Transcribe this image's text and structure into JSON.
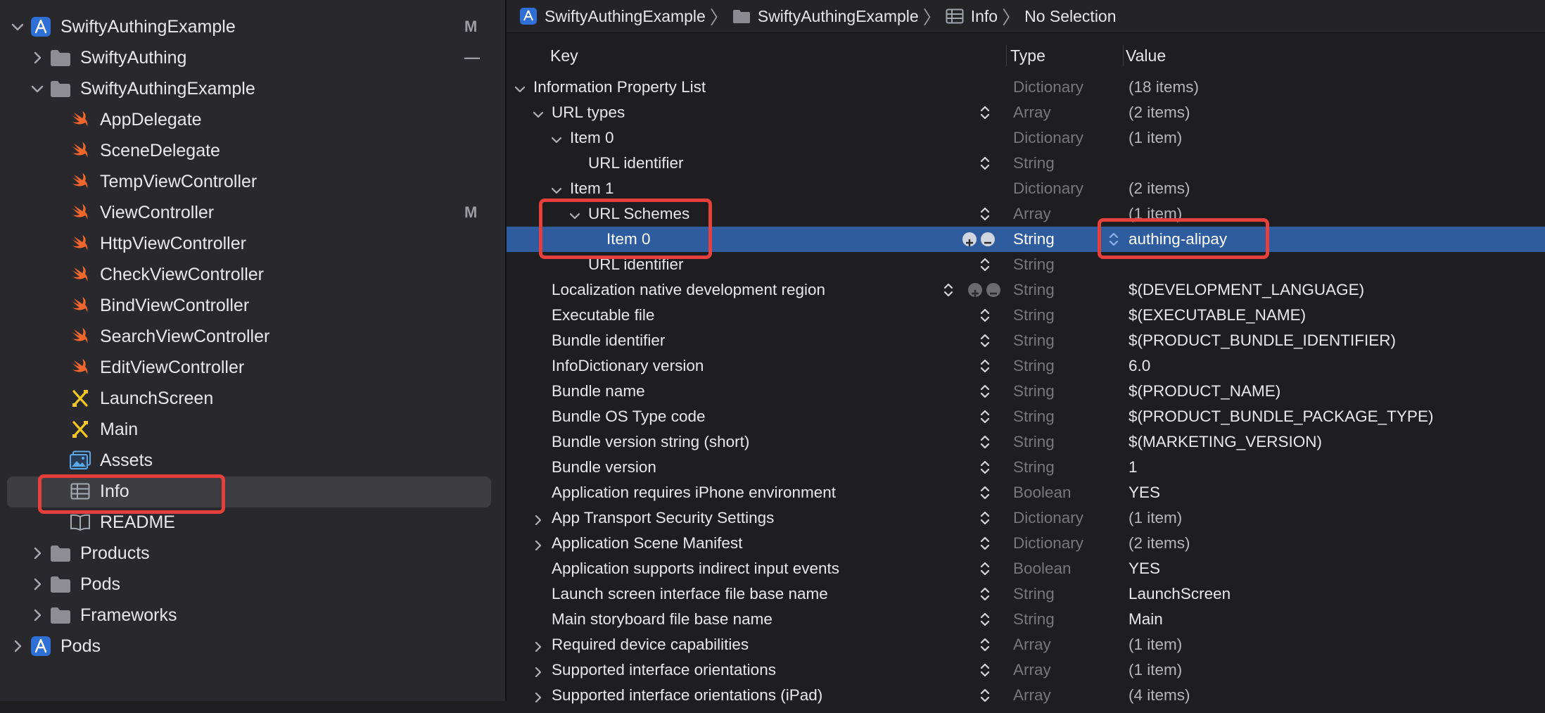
{
  "navigator": {
    "items": [
      {
        "label": "SwiftyAuthingExample",
        "icon": "project-icon",
        "status": "M"
      },
      {
        "label": "SwiftyAuthing",
        "icon": "folder-icon",
        "status": "—"
      },
      {
        "label": "SwiftyAuthingExample",
        "icon": "folder-icon",
        "status": ""
      },
      {
        "label": "AppDelegate",
        "icon": "swift-file-icon",
        "status": ""
      },
      {
        "label": "SceneDelegate",
        "icon": "swift-file-icon",
        "status": ""
      },
      {
        "label": "TempViewController",
        "icon": "swift-file-icon",
        "status": ""
      },
      {
        "label": "ViewController",
        "icon": "swift-file-icon",
        "status": "M"
      },
      {
        "label": "HttpViewController",
        "icon": "swift-file-icon",
        "status": ""
      },
      {
        "label": "CheckViewController",
        "icon": "swift-file-icon",
        "status": ""
      },
      {
        "label": "BindViewController",
        "icon": "swift-file-icon",
        "status": ""
      },
      {
        "label": "SearchViewController",
        "icon": "swift-file-icon",
        "status": ""
      },
      {
        "label": "EditViewController",
        "icon": "swift-file-icon",
        "status": ""
      },
      {
        "label": "LaunchScreen",
        "icon": "storyboard-icon",
        "status": ""
      },
      {
        "label": "Main",
        "icon": "storyboard-icon",
        "status": ""
      },
      {
        "label": "Assets",
        "icon": "assets-icon",
        "status": ""
      },
      {
        "label": "Info",
        "icon": "plist-table-icon",
        "status": ""
      },
      {
        "label": "README",
        "icon": "book-icon",
        "status": ""
      },
      {
        "label": "Products",
        "icon": "folder-icon",
        "status": ""
      },
      {
        "label": "Pods",
        "icon": "folder-icon",
        "status": ""
      },
      {
        "label": "Frameworks",
        "icon": "folder-icon",
        "status": ""
      },
      {
        "label": "Pods",
        "icon": "project-icon",
        "status": ""
      }
    ]
  },
  "jumpbar": {
    "crumbs": [
      "SwiftyAuthingExample",
      "SwiftyAuthingExample",
      "Info",
      "No Selection"
    ]
  },
  "columns": {
    "key": "Key",
    "type": "Type",
    "value": "Value"
  },
  "plist": {
    "rows": [
      {
        "key": "Information Property List",
        "type": "Dictionary",
        "value": "(18 items)"
      },
      {
        "key": "URL types",
        "type": "Array",
        "value": "(2 items)"
      },
      {
        "key": "Item 0",
        "type": "Dictionary",
        "value": "(1 item)"
      },
      {
        "key": "URL identifier",
        "type": "String",
        "value": ""
      },
      {
        "key": "Item 1",
        "type": "Dictionary",
        "value": "(2 items)"
      },
      {
        "key": "URL Schemes",
        "type": "Array",
        "value": "(1 item)"
      },
      {
        "key": "Item 0",
        "type": "String",
        "value": "authing-alipay"
      },
      {
        "key": "URL identifier",
        "type": "String",
        "value": ""
      },
      {
        "key": "Localization native development region",
        "type": "String",
        "value": "$(DEVELOPMENT_LANGUAGE)"
      },
      {
        "key": "Executable file",
        "type": "String",
        "value": "$(EXECUTABLE_NAME)"
      },
      {
        "key": "Bundle identifier",
        "type": "String",
        "value": "$(PRODUCT_BUNDLE_IDENTIFIER)"
      },
      {
        "key": "InfoDictionary version",
        "type": "String",
        "value": "6.0"
      },
      {
        "key": "Bundle name",
        "type": "String",
        "value": "$(PRODUCT_NAME)"
      },
      {
        "key": "Bundle OS Type code",
        "type": "String",
        "value": "$(PRODUCT_BUNDLE_PACKAGE_TYPE)"
      },
      {
        "key": "Bundle version string (short)",
        "type": "String",
        "value": "$(MARKETING_VERSION)"
      },
      {
        "key": "Bundle version",
        "type": "String",
        "value": "1"
      },
      {
        "key": "Application requires iPhone environment",
        "type": "Boolean",
        "value": "YES"
      },
      {
        "key": "App Transport Security Settings",
        "type": "Dictionary",
        "value": "(1 item)"
      },
      {
        "key": "Application Scene Manifest",
        "type": "Dictionary",
        "value": "(2 items)"
      },
      {
        "key": "Application supports indirect input events",
        "type": "Boolean",
        "value": "YES"
      },
      {
        "key": "Launch screen interface file base name",
        "type": "String",
        "value": "LaunchScreen"
      },
      {
        "key": "Main storyboard file base name",
        "type": "String",
        "value": "Main"
      },
      {
        "key": "Required device capabilities",
        "type": "Array",
        "value": "(1 item)"
      },
      {
        "key": "Supported interface orientations",
        "type": "Array",
        "value": "(1 item)"
      },
      {
        "key": "Supported interface orientations (iPad)",
        "type": "Array",
        "value": "(4 items)"
      }
    ]
  },
  "colors": {
    "selection": "#2f5c9e",
    "highlight_box": "#e5403b",
    "swift_icon": "#f0672e",
    "project_icon": "#2f6fd6"
  }
}
